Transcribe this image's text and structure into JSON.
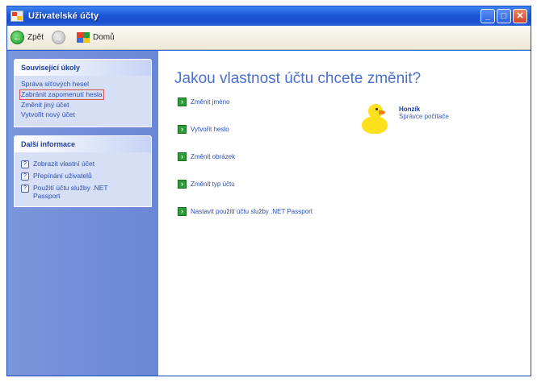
{
  "window": {
    "title": "Uživatelské účty"
  },
  "toolbar": {
    "back_label": "Zpět",
    "home_label": "Domů"
  },
  "sidebar": {
    "related_tasks": {
      "heading": "Související úkoly",
      "links": [
        "Správa síťových hesel",
        "Zabránit zapomenutí hesla",
        "Změnit jiný účet",
        "Vytvořit nový účet"
      ],
      "selected_index": 1
    },
    "more_info": {
      "heading": "Další informace",
      "items": [
        "Zobrazit vlastní účet",
        "Přepínání uživatelů",
        "Použití účtu služby .NET Passport"
      ]
    }
  },
  "main": {
    "title": "Jakou vlastnost účtu chcete změnit?",
    "tasks": [
      "Změnit jméno",
      "Vytvořit heslo",
      "Změnit obrázek",
      "Změnit typ účtu",
      "Nastavit použití účtu služby .NET Passport"
    ]
  },
  "user": {
    "name": "Honzík",
    "role": "Správce počítače"
  },
  "colors": {
    "title_bar": "#1b56d8",
    "sidebar": "#7c96dc",
    "heading_blue": "#4a6fcf",
    "task_icon": "#2e9b3a"
  }
}
